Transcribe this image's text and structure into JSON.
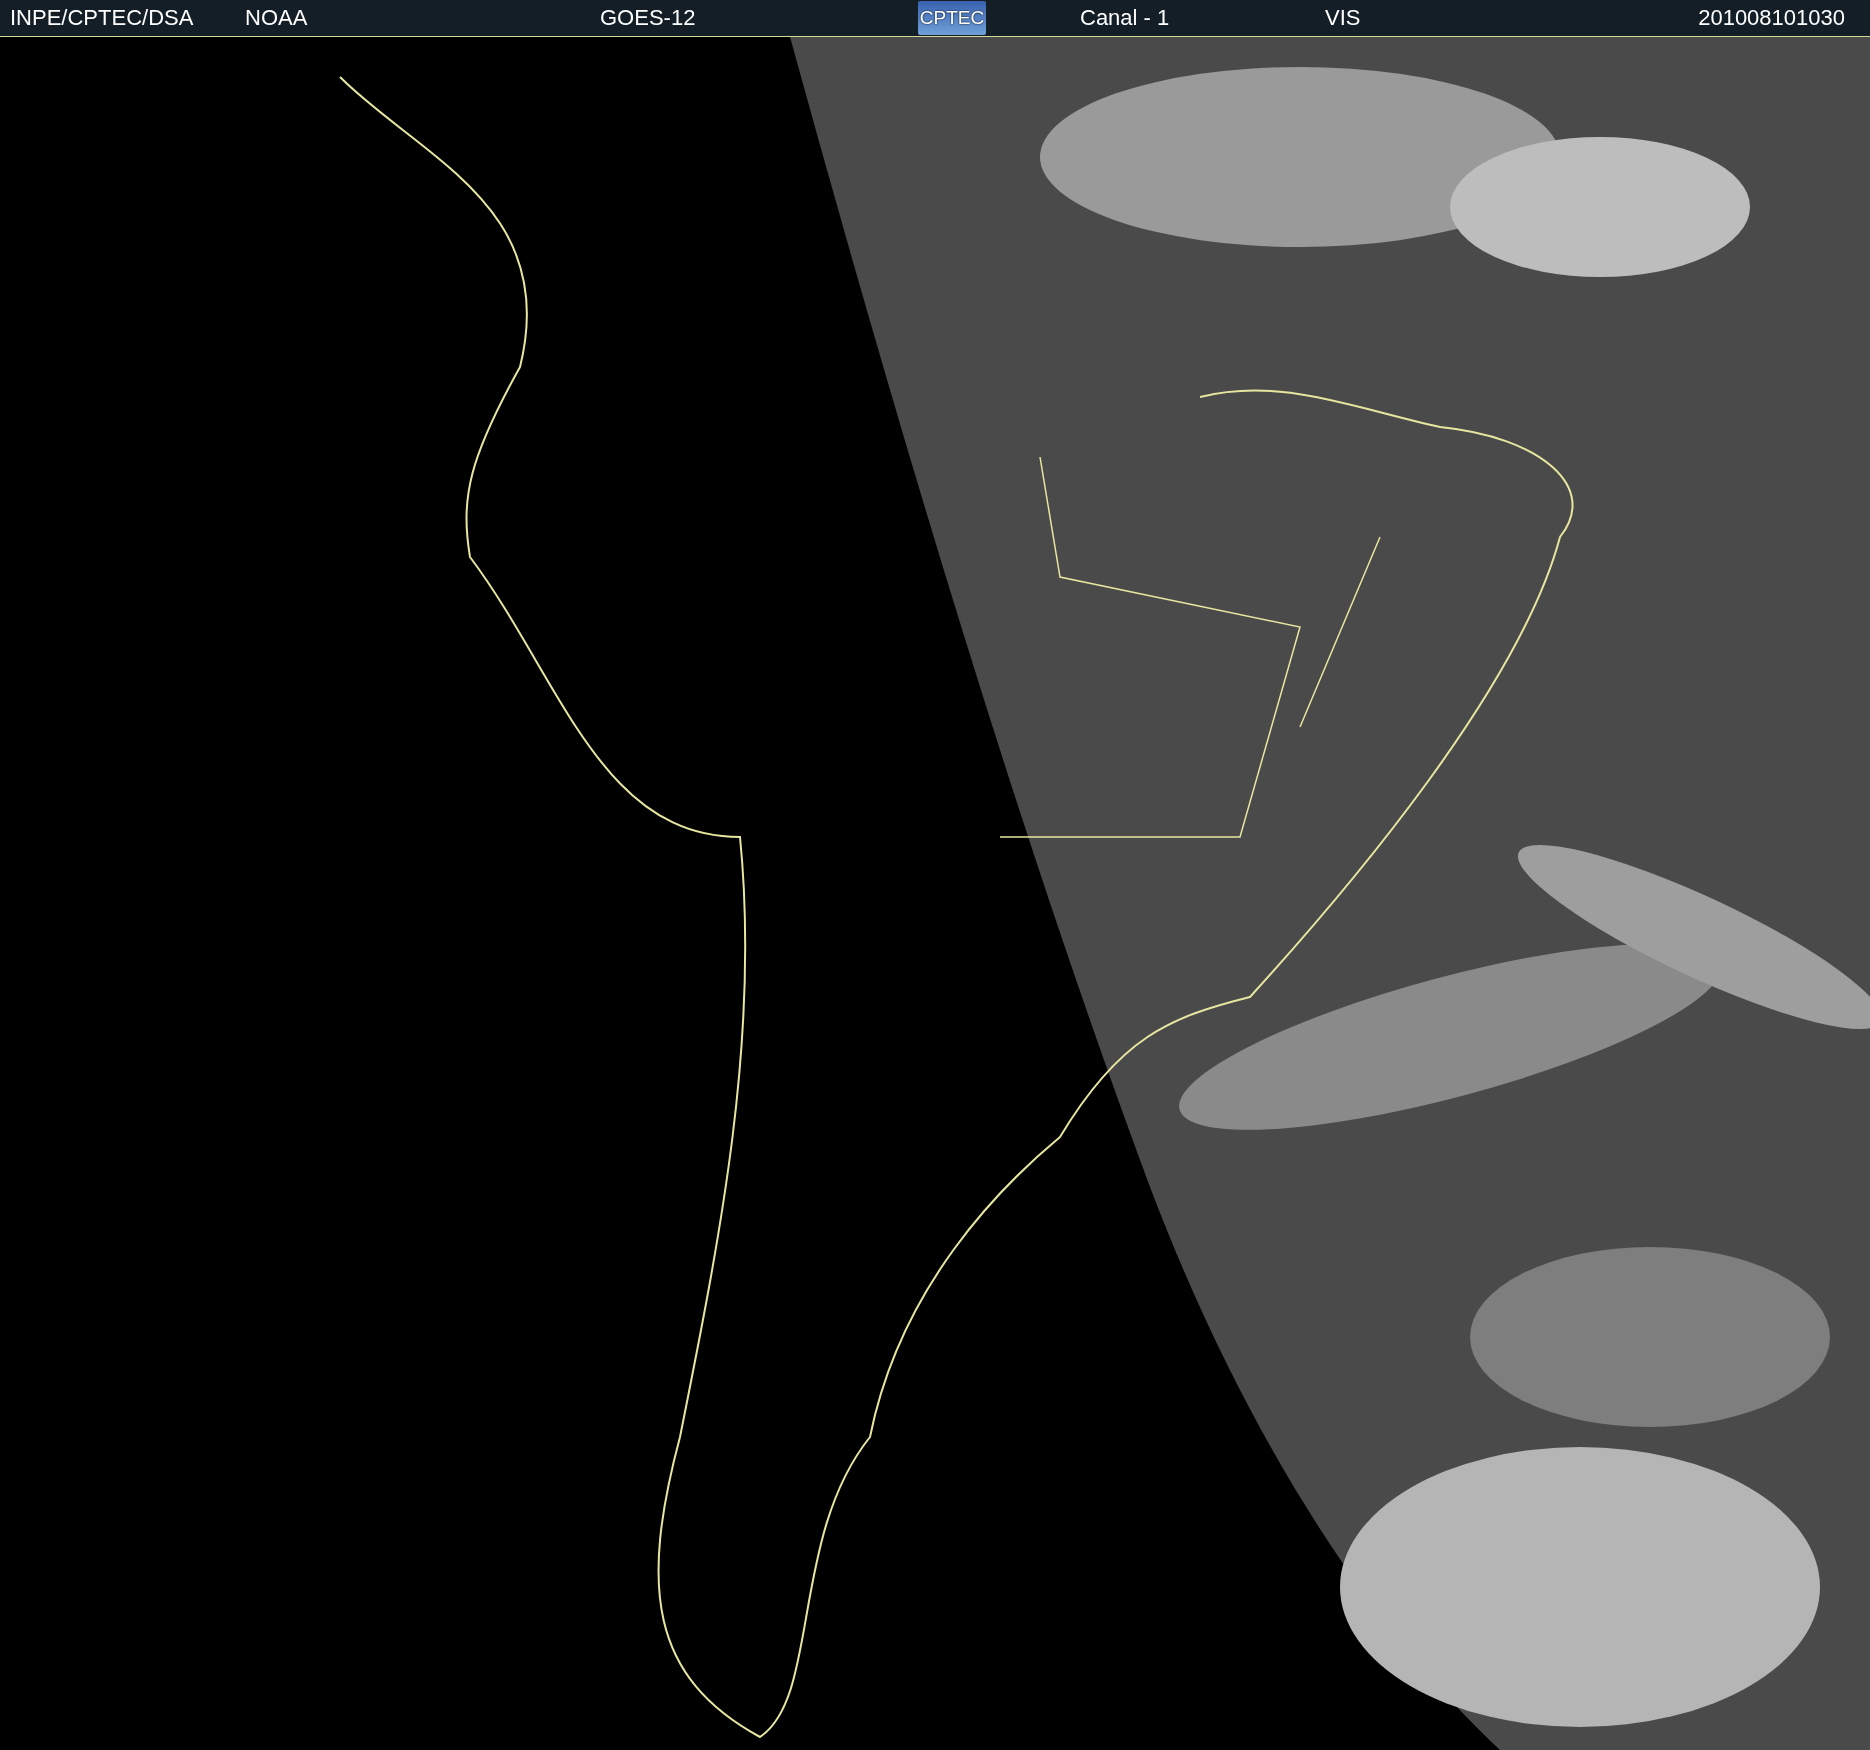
{
  "header": {
    "source": "INPE/CPTEC/DSA",
    "agency": "NOAA",
    "satellite": "GOES-12",
    "logo": "CPTEC",
    "channel": "Canal - 1",
    "band": "VIS",
    "timestamp": "201008101030"
  }
}
